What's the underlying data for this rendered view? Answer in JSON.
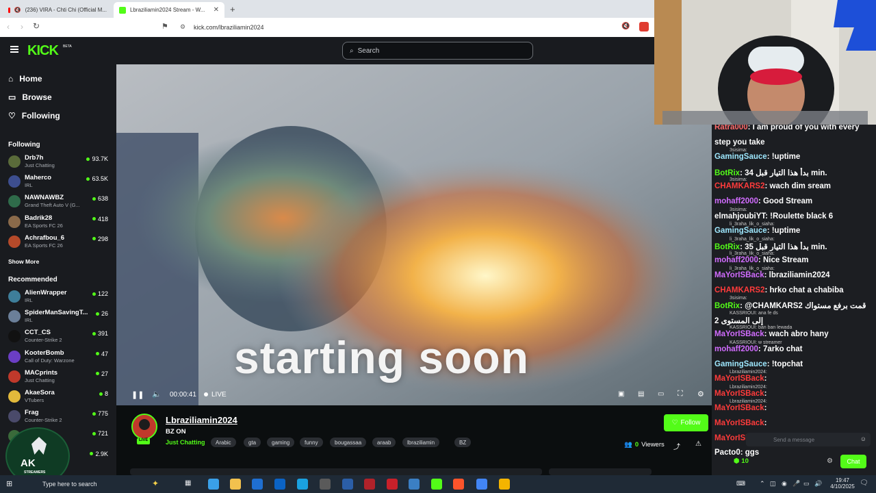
{
  "browser": {
    "tabs": [
      {
        "label": "(236) VIRA - Chti Chi (Official M...",
        "active": false
      },
      {
        "label": "Lbraziliamin2024 Stream - W...",
        "active": true
      }
    ],
    "new_tab": "+",
    "url": "kick.com/lbraziliamin2024"
  },
  "kick": {
    "logo": "KICK",
    "logo_badge": "BETA",
    "search_placeholder": "Search",
    "nav": [
      {
        "label": "Home",
        "icon": "home-icon"
      },
      {
        "label": "Browse",
        "icon": "browse-icon"
      },
      {
        "label": "Following",
        "icon": "heart-icon"
      }
    ],
    "following_title": "Following",
    "following": [
      {
        "name": "Drb7h",
        "category": "Just Chatting",
        "viewers": "93.7K",
        "color": "#5a6b3a"
      },
      {
        "name": "Maherco",
        "category": "IRL",
        "viewers": "63.5K",
        "color": "#3d4e8f"
      },
      {
        "name": "NAWNAWBZ",
        "category": "Grand Theft Auto V (G...",
        "viewers": "638",
        "color": "#2f6b4a"
      },
      {
        "name": "Badrik28",
        "category": "EA Sports FC 26",
        "viewers": "418",
        "color": "#8a6a4a"
      },
      {
        "name": "Achrafbou_6",
        "category": "EA Sports FC 26",
        "viewers": "298",
        "color": "#b54a2a"
      }
    ],
    "show_more": "Show More",
    "recommended_title": "Recommended",
    "recommended": [
      {
        "name": "AlienWrapper",
        "category": "IRL",
        "viewers": "122",
        "color": "#3e7e9a"
      },
      {
        "name": "SpiderManSavingT...",
        "category": "IRL",
        "viewers": "26",
        "color": "#6b7f99"
      },
      {
        "name": "CCT_CS",
        "category": "Counter-Strike 2",
        "viewers": "391",
        "color": "#111111"
      },
      {
        "name": "KooterBomb",
        "category": "Call of Duty: Warzone",
        "viewers": "47",
        "color": "#6b3ec4"
      },
      {
        "name": "MACprints",
        "category": "Just Chatting",
        "viewers": "27",
        "color": "#c0392b"
      },
      {
        "name": "AkaeSora",
        "category": "VTubers",
        "viewers": "8",
        "color": "#e2b93b"
      },
      {
        "name": "Frag",
        "category": "Counter-Strike 2",
        "viewers": "775",
        "color": "#4a4a6a"
      },
      {
        "name": "",
        "category": "",
        "viewers": "721",
        "color": "#3a6a3a"
      },
      {
        "name": "",
        "category": "",
        "viewers": "2.9K",
        "color": "#3a3a3a"
      }
    ]
  },
  "video": {
    "overlay_text": "starting soon",
    "time": "00:00:41",
    "live_label": "LIVE"
  },
  "stream": {
    "channel": "Lbraziliamin2024",
    "title": "BZ ON",
    "category": "Just Chatting",
    "live_badge": "LIVE",
    "tags": [
      "Arabic",
      "gta",
      "gaming",
      "funny",
      "bougassaa",
      "araab",
      "lbraziliamin",
      "BZ"
    ],
    "follow": "Follow",
    "viewers_count": "0",
    "viewers_label": "Viewers"
  },
  "chat": {
    "messages": [
      {
        "user": "Ratra000",
        "text": ": I am proud of you with every",
        "color": "#ff6b6b",
        "sub": ""
      },
      {
        "user": "",
        "text": "step you take",
        "color": "#ffffff",
        "sub": ""
      },
      {
        "user": "GamingSauce",
        "text": ": !uptime",
        "color": "#9ee8ff",
        "sub": "3sisima:"
      },
      {
        "user": "BotRix",
        "text": ": بدأ هذا التيار قبل 34 min.",
        "color": "#53fc18",
        "sub": ""
      },
      {
        "user": "CHAMKARS2",
        "text": ": wach dim sream",
        "color": "#ff3b3b",
        "sub": "3sisima:"
      },
      {
        "user": "mohaff2000",
        "text": ": Good Stream",
        "color": "#d16cff",
        "sub": ""
      },
      {
        "user": "elmahjoubiYT",
        "text": ": !Roulette black 6",
        "color": "#ffffff",
        "sub": "3sisima:"
      },
      {
        "user": "GamingSauce",
        "text": ": !uptime",
        "color": "#9ee8ff",
        "sub": "li_3raha_lik_o_siaha:"
      },
      {
        "user": "BotRix",
        "text": ": بدأ هذا التيار قبل 35 min.",
        "color": "#53fc18",
        "sub": "li_3raha_lik_o_siaha:"
      },
      {
        "user": "mohaff2000",
        "text": ": Nice Stream",
        "color": "#d16cff",
        "sub": "li_3raha_lik_o_siaha:"
      },
      {
        "user": "MaYorISBack",
        "text": ": lbraziliamin2024",
        "color": "#d16cff",
        "sub": "li_3raha_lik_o_siaha:"
      },
      {
        "user": "CHAMKARS2",
        "text": ": hrko chat a chabiba",
        "color": "#ff3b3b",
        "sub": ""
      },
      {
        "user": "BotRix",
        "text": ": @CHAMKARS2 قمت برفع مستواك",
        "color": "#53fc18",
        "sub": "3sisima:"
      },
      {
        "user": "",
        "text": "إلى المستوى 2",
        "color": "#ffffff",
        "sub": "KASSRIOUI: ana fe ds"
      },
      {
        "user": "MaYorISBack",
        "text": ": wach abro hany",
        "color": "#d16cff",
        "sub": "KASSRIOUI: ban ban lewada"
      },
      {
        "user": "mohaff2000",
        "text": ": 7arko chat",
        "color": "#d16cff",
        "sub": "KASSRIOUI: w streamer"
      },
      {
        "user": "GamingSauce",
        "text": ": !topchat",
        "color": "#9ee8ff",
        "sub": ""
      },
      {
        "user": "MaYorISBack",
        "text": ":",
        "color": "#ff3b3b",
        "sub": "Lbraziliamin2024:"
      },
      {
        "user": "MaYorISBack",
        "text": ":",
        "color": "#ff3b3b",
        "sub": "Lbraziliamin2024:"
      },
      {
        "user": "MaYorISBack",
        "text": ":",
        "color": "#ff3b3b",
        "sub": "Lbraziliamin2024:"
      },
      {
        "user": "MaYorISBack",
        "text": ":",
        "color": "#ff3b3b",
        "sub": ""
      },
      {
        "user": "MaYorISBack",
        "text": ":",
        "color": "#ff3b3b",
        "sub": ""
      },
      {
        "user": "Pacto0",
        "text": ": ggs",
        "color": "#ffffff",
        "sub": ""
      }
    ],
    "input_placeholder": "Send a message",
    "points": "10",
    "chat_button": "Chat"
  },
  "overlay": {
    "logo_text": "AK",
    "logo_sub": "STREAMERS"
  },
  "taskbar": {
    "search_placeholder": "Type here to search",
    "time": "19:47",
    "date": "4/10/2025"
  },
  "colors": {
    "kick_green": "#53fc18",
    "bg_dark": "#0b0e0f",
    "panel": "#191b1f",
    "chat_bg": "#1c1e22"
  }
}
